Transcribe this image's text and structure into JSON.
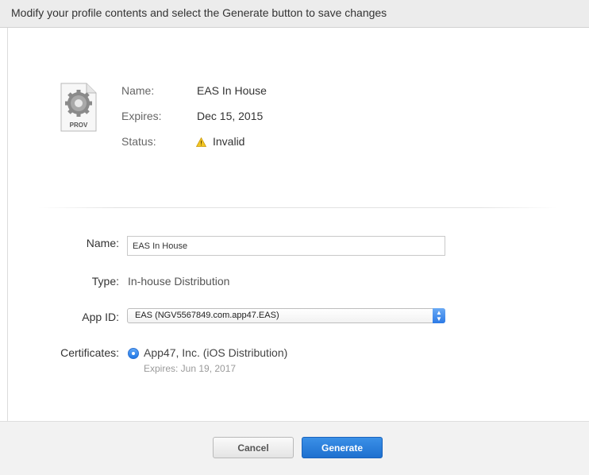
{
  "header": {
    "instruction": "Modify your profile contents and select the Generate button to save changes"
  },
  "summary": {
    "icon_label": "PROV",
    "name_label": "Name:",
    "name_value": "EAS In House",
    "expires_label": "Expires:",
    "expires_value": "Dec 15, 2015",
    "status_label": "Status:",
    "status_value": "Invalid"
  },
  "form": {
    "name_label": "Name:",
    "name_value": "EAS In House",
    "type_label": "Type:",
    "type_value": "In-house Distribution",
    "appid_label": "App ID:",
    "appid_value": "EAS (NGV5567849.com.app47.EAS)",
    "certificates_label": "Certificates:",
    "certificate_name": "App47, Inc. (iOS Distribution)",
    "certificate_expires": "Expires: Jun 19, 2017"
  },
  "footer": {
    "cancel_label": "Cancel",
    "generate_label": "Generate"
  },
  "colors": {
    "accent": "#1e70cf",
    "warning": "#f3c623"
  }
}
